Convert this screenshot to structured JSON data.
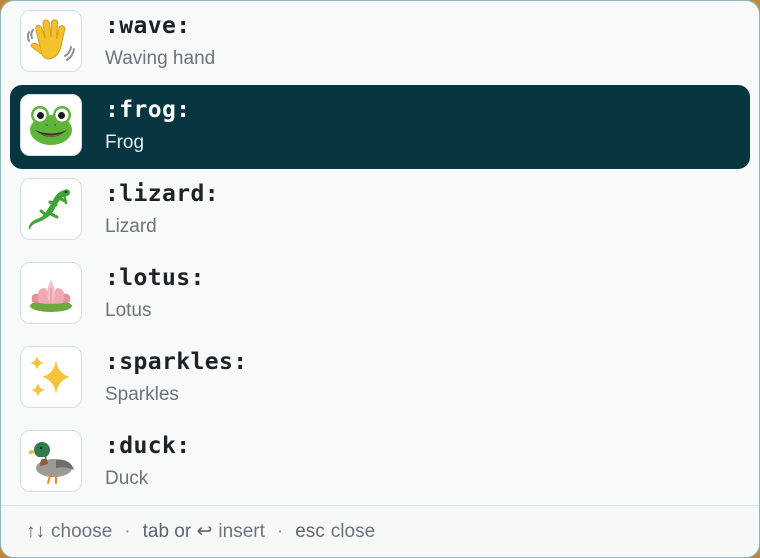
{
  "items": [
    {
      "code": ":wave:",
      "name": "Waving hand",
      "icon": "waving-hand-emoji",
      "selected": false
    },
    {
      "code": ":frog:",
      "name": "Frog",
      "icon": "frog-emoji",
      "selected": true
    },
    {
      "code": ":lizard:",
      "name": "Lizard",
      "icon": "lizard-emoji",
      "selected": false
    },
    {
      "code": ":lotus:",
      "name": "Lotus",
      "icon": "lotus-emoji",
      "selected": false
    },
    {
      "code": ":sparkles:",
      "name": "Sparkles",
      "icon": "sparkles-emoji",
      "selected": false
    },
    {
      "code": ":duck:",
      "name": "Duck",
      "icon": "duck-emoji",
      "selected": false
    }
  ],
  "footer": {
    "choose_keys": "↑↓",
    "choose_label": "choose",
    "separator": "·",
    "insert_keys": "tab or ↩",
    "insert_label": "insert",
    "close_key": "esc",
    "close_label": "close"
  },
  "colors": {
    "selected_row": "#083640",
    "panel_bg": "#f8f9f9",
    "panel_border": "#8fb7bd"
  }
}
